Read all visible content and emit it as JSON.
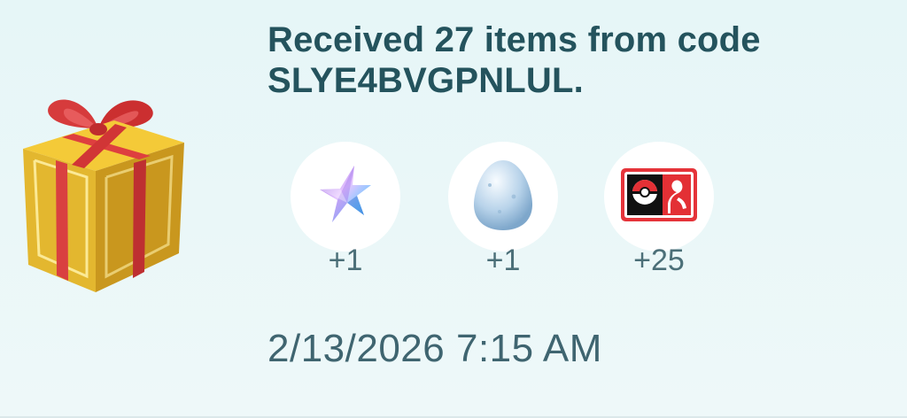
{
  "card": {
    "title": "Received 27 items from code SLYE4BVGPNLUL.",
    "timestamp": "2/13/2026 7:15 AM"
  },
  "items": [
    {
      "icon": "stardust-star-icon",
      "count": "+1"
    },
    {
      "icon": "egg-icon",
      "count": "+1"
    },
    {
      "icon": "pokemon-trainer-card-icon",
      "count": "+25"
    }
  ],
  "colors": {
    "title": "#24535d",
    "text": "#4b6f78",
    "background": "#e6f6f7",
    "gift_gold": "#d9ad2b",
    "ribbon_red": "#d9403f"
  }
}
